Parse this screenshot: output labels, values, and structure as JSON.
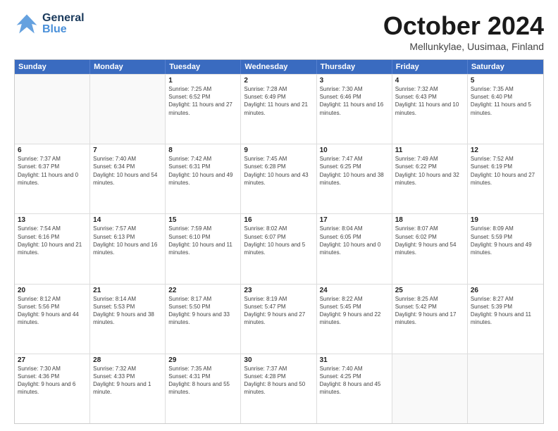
{
  "header": {
    "logo_general": "General",
    "logo_blue": "Blue",
    "title": "October 2024",
    "location": "Mellunkylae, Uusimaa, Finland"
  },
  "calendar": {
    "days_of_week": [
      "Sunday",
      "Monday",
      "Tuesday",
      "Wednesday",
      "Thursday",
      "Friday",
      "Saturday"
    ],
    "rows": [
      [
        {
          "day": "",
          "sunrise": "",
          "sunset": "",
          "daylight": ""
        },
        {
          "day": "",
          "sunrise": "",
          "sunset": "",
          "daylight": ""
        },
        {
          "day": "1",
          "sunrise": "Sunrise: 7:25 AM",
          "sunset": "Sunset: 6:52 PM",
          "daylight": "Daylight: 11 hours and 27 minutes."
        },
        {
          "day": "2",
          "sunrise": "Sunrise: 7:28 AM",
          "sunset": "Sunset: 6:49 PM",
          "daylight": "Daylight: 11 hours and 21 minutes."
        },
        {
          "day": "3",
          "sunrise": "Sunrise: 7:30 AM",
          "sunset": "Sunset: 6:46 PM",
          "daylight": "Daylight: 11 hours and 16 minutes."
        },
        {
          "day": "4",
          "sunrise": "Sunrise: 7:32 AM",
          "sunset": "Sunset: 6:43 PM",
          "daylight": "Daylight: 11 hours and 10 minutes."
        },
        {
          "day": "5",
          "sunrise": "Sunrise: 7:35 AM",
          "sunset": "Sunset: 6:40 PM",
          "daylight": "Daylight: 11 hours and 5 minutes."
        }
      ],
      [
        {
          "day": "6",
          "sunrise": "Sunrise: 7:37 AM",
          "sunset": "Sunset: 6:37 PM",
          "daylight": "Daylight: 11 hours and 0 minutes."
        },
        {
          "day": "7",
          "sunrise": "Sunrise: 7:40 AM",
          "sunset": "Sunset: 6:34 PM",
          "daylight": "Daylight: 10 hours and 54 minutes."
        },
        {
          "day": "8",
          "sunrise": "Sunrise: 7:42 AM",
          "sunset": "Sunset: 6:31 PM",
          "daylight": "Daylight: 10 hours and 49 minutes."
        },
        {
          "day": "9",
          "sunrise": "Sunrise: 7:45 AM",
          "sunset": "Sunset: 6:28 PM",
          "daylight": "Daylight: 10 hours and 43 minutes."
        },
        {
          "day": "10",
          "sunrise": "Sunrise: 7:47 AM",
          "sunset": "Sunset: 6:25 PM",
          "daylight": "Daylight: 10 hours and 38 minutes."
        },
        {
          "day": "11",
          "sunrise": "Sunrise: 7:49 AM",
          "sunset": "Sunset: 6:22 PM",
          "daylight": "Daylight: 10 hours and 32 minutes."
        },
        {
          "day": "12",
          "sunrise": "Sunrise: 7:52 AM",
          "sunset": "Sunset: 6:19 PM",
          "daylight": "Daylight: 10 hours and 27 minutes."
        }
      ],
      [
        {
          "day": "13",
          "sunrise": "Sunrise: 7:54 AM",
          "sunset": "Sunset: 6:16 PM",
          "daylight": "Daylight: 10 hours and 21 minutes."
        },
        {
          "day": "14",
          "sunrise": "Sunrise: 7:57 AM",
          "sunset": "Sunset: 6:13 PM",
          "daylight": "Daylight: 10 hours and 16 minutes."
        },
        {
          "day": "15",
          "sunrise": "Sunrise: 7:59 AM",
          "sunset": "Sunset: 6:10 PM",
          "daylight": "Daylight: 10 hours and 11 minutes."
        },
        {
          "day": "16",
          "sunrise": "Sunrise: 8:02 AM",
          "sunset": "Sunset: 6:07 PM",
          "daylight": "Daylight: 10 hours and 5 minutes."
        },
        {
          "day": "17",
          "sunrise": "Sunrise: 8:04 AM",
          "sunset": "Sunset: 6:05 PM",
          "daylight": "Daylight: 10 hours and 0 minutes."
        },
        {
          "day": "18",
          "sunrise": "Sunrise: 8:07 AM",
          "sunset": "Sunset: 6:02 PM",
          "daylight": "Daylight: 9 hours and 54 minutes."
        },
        {
          "day": "19",
          "sunrise": "Sunrise: 8:09 AM",
          "sunset": "Sunset: 5:59 PM",
          "daylight": "Daylight: 9 hours and 49 minutes."
        }
      ],
      [
        {
          "day": "20",
          "sunrise": "Sunrise: 8:12 AM",
          "sunset": "Sunset: 5:56 PM",
          "daylight": "Daylight: 9 hours and 44 minutes."
        },
        {
          "day": "21",
          "sunrise": "Sunrise: 8:14 AM",
          "sunset": "Sunset: 5:53 PM",
          "daylight": "Daylight: 9 hours and 38 minutes."
        },
        {
          "day": "22",
          "sunrise": "Sunrise: 8:17 AM",
          "sunset": "Sunset: 5:50 PM",
          "daylight": "Daylight: 9 hours and 33 minutes."
        },
        {
          "day": "23",
          "sunrise": "Sunrise: 8:19 AM",
          "sunset": "Sunset: 5:47 PM",
          "daylight": "Daylight: 9 hours and 27 minutes."
        },
        {
          "day": "24",
          "sunrise": "Sunrise: 8:22 AM",
          "sunset": "Sunset: 5:45 PM",
          "daylight": "Daylight: 9 hours and 22 minutes."
        },
        {
          "day": "25",
          "sunrise": "Sunrise: 8:25 AM",
          "sunset": "Sunset: 5:42 PM",
          "daylight": "Daylight: 9 hours and 17 minutes."
        },
        {
          "day": "26",
          "sunrise": "Sunrise: 8:27 AM",
          "sunset": "Sunset: 5:39 PM",
          "daylight": "Daylight: 9 hours and 11 minutes."
        }
      ],
      [
        {
          "day": "27",
          "sunrise": "Sunrise: 7:30 AM",
          "sunset": "Sunset: 4:36 PM",
          "daylight": "Daylight: 9 hours and 6 minutes."
        },
        {
          "day": "28",
          "sunrise": "Sunrise: 7:32 AM",
          "sunset": "Sunset: 4:33 PM",
          "daylight": "Daylight: 9 hours and 1 minute."
        },
        {
          "day": "29",
          "sunrise": "Sunrise: 7:35 AM",
          "sunset": "Sunset: 4:31 PM",
          "daylight": "Daylight: 8 hours and 55 minutes."
        },
        {
          "day": "30",
          "sunrise": "Sunrise: 7:37 AM",
          "sunset": "Sunset: 4:28 PM",
          "daylight": "Daylight: 8 hours and 50 minutes."
        },
        {
          "day": "31",
          "sunrise": "Sunrise: 7:40 AM",
          "sunset": "Sunset: 4:25 PM",
          "daylight": "Daylight: 8 hours and 45 minutes."
        },
        {
          "day": "",
          "sunrise": "",
          "sunset": "",
          "daylight": ""
        },
        {
          "day": "",
          "sunrise": "",
          "sunset": "",
          "daylight": ""
        }
      ]
    ]
  }
}
